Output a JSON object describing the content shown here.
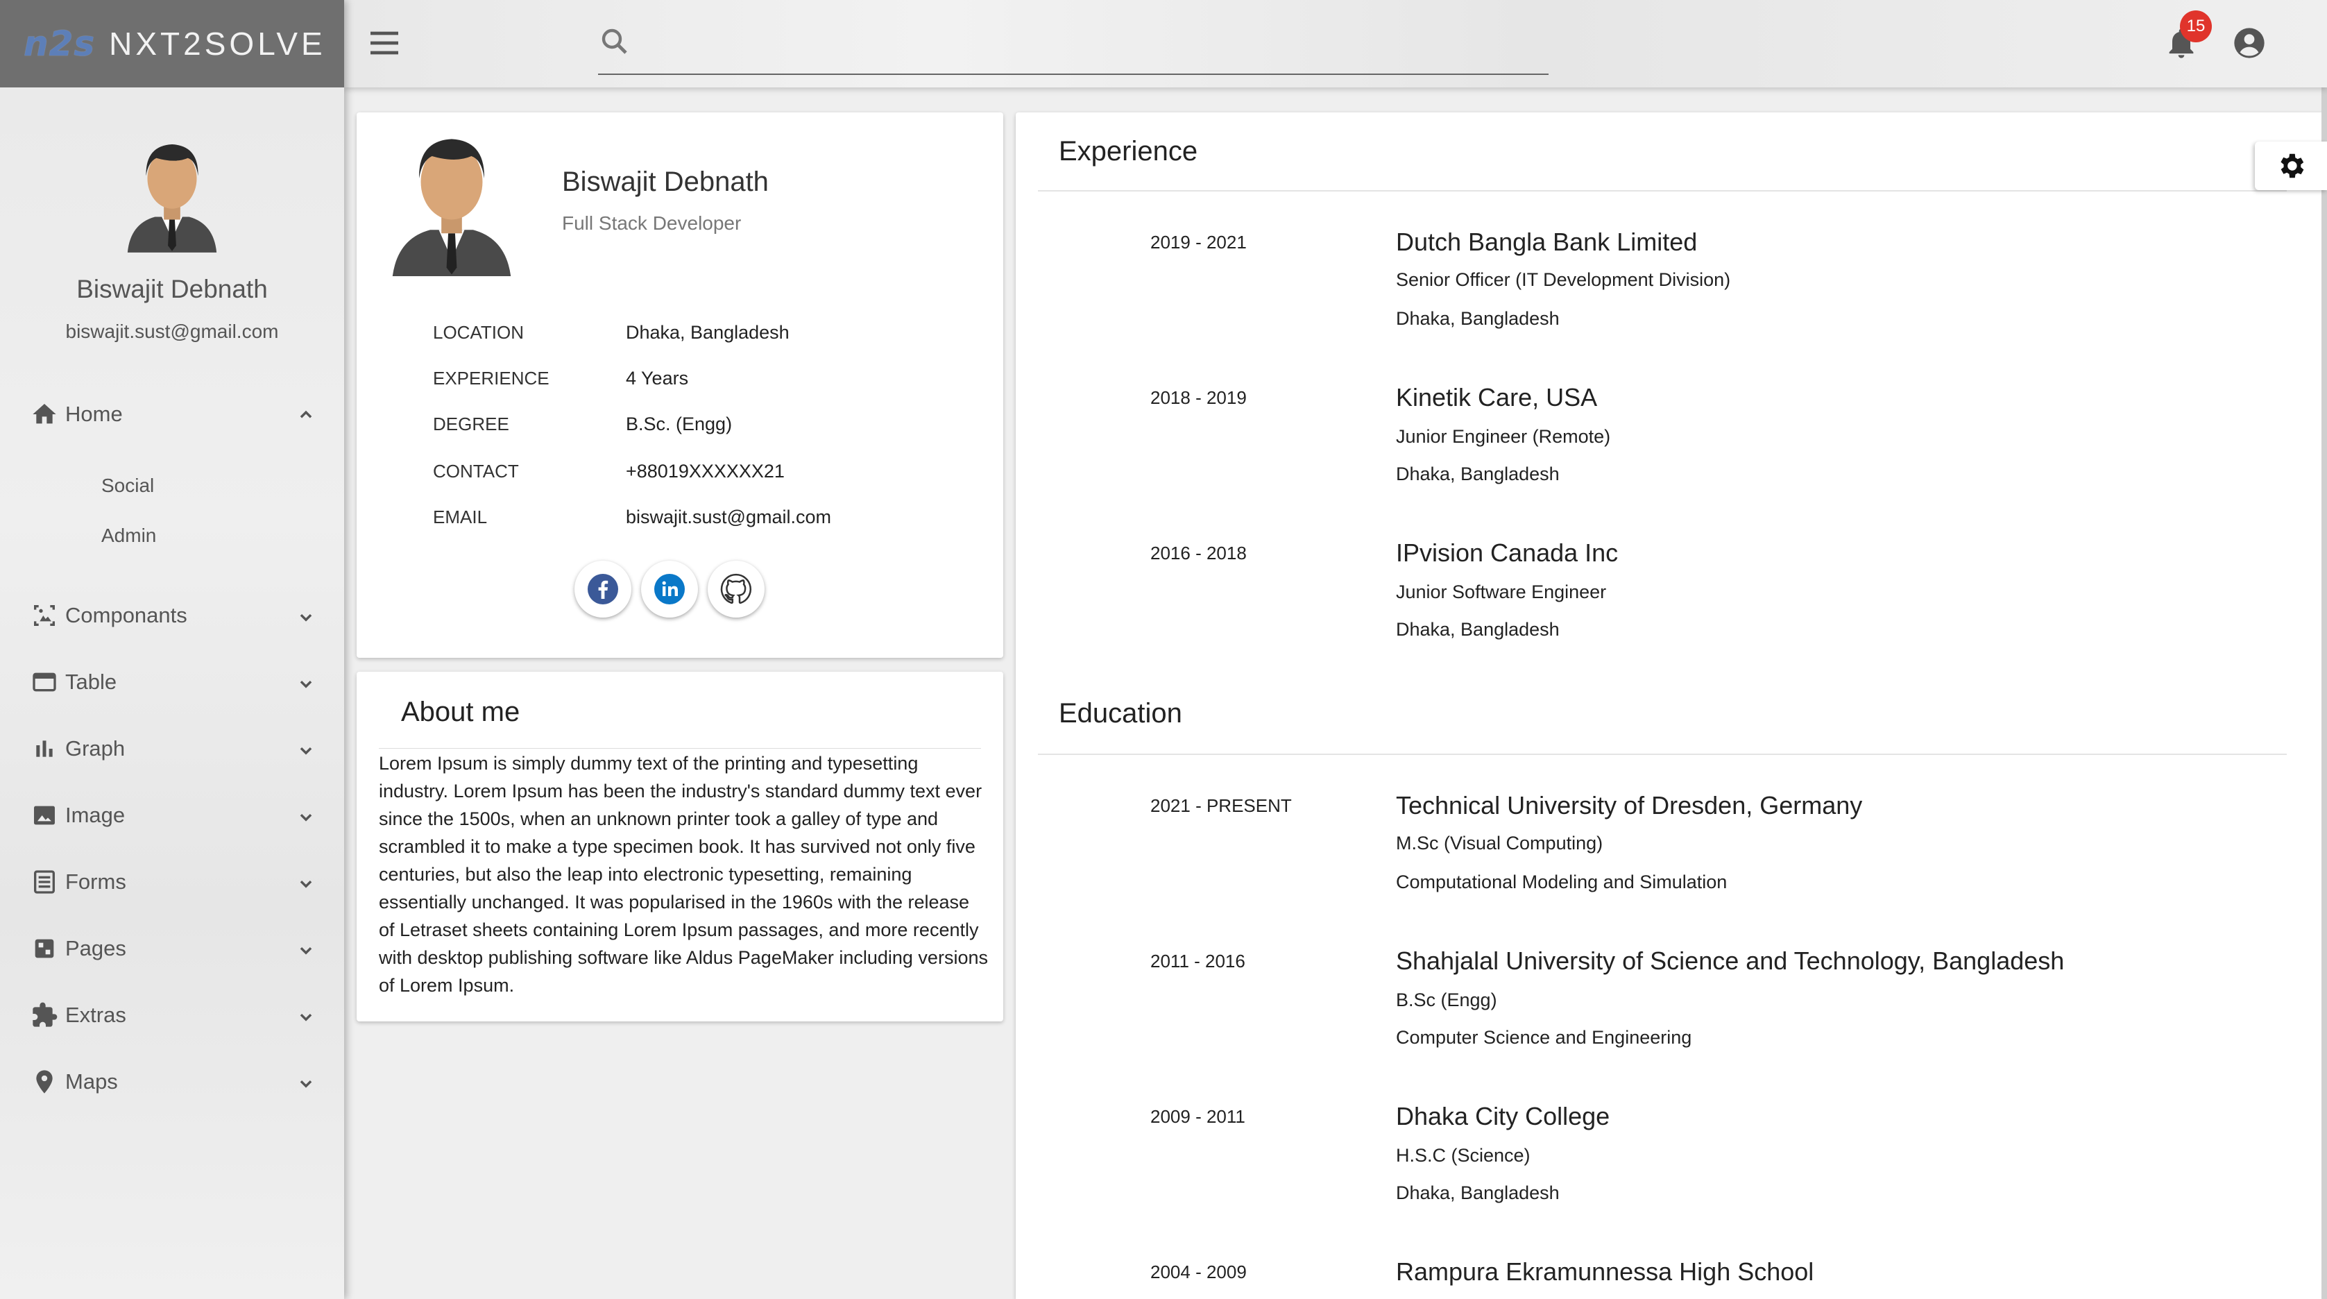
{
  "brand": {
    "logo": "n2s",
    "name": "NXT2SOLVE"
  },
  "sidebar": {
    "user_name": "Biswajit Debnath",
    "user_email": "biswajit.sust@gmail.com",
    "items": [
      {
        "label": "Home",
        "icon": "home-icon",
        "expanded": true
      },
      {
        "label": "Componants",
        "icon": "components-icon"
      },
      {
        "label": "Table",
        "icon": "table-icon"
      },
      {
        "label": "Graph",
        "icon": "graph-icon"
      },
      {
        "label": "Image",
        "icon": "image-icon"
      },
      {
        "label": "Forms",
        "icon": "forms-icon"
      },
      {
        "label": "Pages",
        "icon": "pages-icon"
      },
      {
        "label": "Extras",
        "icon": "puzzle-icon"
      },
      {
        "label": "Maps",
        "icon": "map-pin-icon"
      }
    ],
    "home_subitems": [
      "Social",
      "Admin"
    ]
  },
  "topbar": {
    "search_placeholder": "",
    "notification_count": "15",
    "icons": [
      "menu-icon",
      "search-icon",
      "feedback-icon",
      "bell-icon",
      "account-icon"
    ]
  },
  "profile": {
    "name": "Biswajit Debnath",
    "title": "Full Stack Developer",
    "info": [
      {
        "label": "LOCATION",
        "value": "Dhaka, Bangladesh"
      },
      {
        "label": "EXPERIENCE",
        "value": "4 Years"
      },
      {
        "label": "DEGREE",
        "value": "B.Sc. (Engg)"
      },
      {
        "label": "CONTACT",
        "value": "+88019XXXXXX21"
      },
      {
        "label": "EMAIL",
        "value": "biswajit.sust@gmail.com"
      }
    ],
    "social": [
      "facebook-icon",
      "linkedin-icon",
      "github-icon"
    ],
    "colors": {
      "facebook": "#3b5998",
      "linkedin": "#0a78c8",
      "github": "#333333"
    }
  },
  "about": {
    "title": "About me",
    "text": "Lorem Ipsum is simply dummy text of the printing and typesetting industry. Lorem Ipsum has been the industry's standard dummy text ever since the 1500s, when an unknown printer took a galley of type and scrambled it to make a type specimen book. It has survived not only five centuries, but also the leap into electronic typesetting, remaining essentially unchanged. It was popularised in the 1960s with the release of Letraset sheets containing Lorem Ipsum passages, and more recently with desktop publishing software like Aldus PageMaker including versions of Lorem Ipsum."
  },
  "experience": {
    "title": "Experience",
    "entries": [
      {
        "date": "2019 - 2021",
        "title": "Dutch Bangla Bank Limited",
        "sub": "Senior Officer (IT Development Division)",
        "loc": "Dhaka, Bangladesh"
      },
      {
        "date": "2018 - 2019",
        "title": "Kinetik Care, USA",
        "sub": "Junior Engineer (Remote)",
        "loc": "Dhaka, Bangladesh"
      },
      {
        "date": "2016 - 2018",
        "title": "IPvision Canada Inc",
        "sub": "Junior Software Engineer",
        "loc": "Dhaka, Bangladesh"
      }
    ]
  },
  "education": {
    "title": "Education",
    "entries": [
      {
        "date": "2021 - PRESENT",
        "title": "Technical University of Dresden, Germany",
        "sub": "M.Sc (Visual Computing)",
        "loc": "Computational Modeling and Simulation"
      },
      {
        "date": "2011 - 2016",
        "title": "Shahjalal University of Science and Technology, Bangladesh",
        "sub": "B.Sc (Engg)",
        "loc": "Computer Science and Engineering"
      },
      {
        "date": "2009 - 2011",
        "title": "Dhaka City College",
        "sub": "H.S.C (Science)",
        "loc": "Dhaka, Bangladesh"
      },
      {
        "date": "2004 - 2009",
        "title": "Rampura Ekramunnessa High School",
        "sub": "",
        "loc": ""
      }
    ]
  }
}
